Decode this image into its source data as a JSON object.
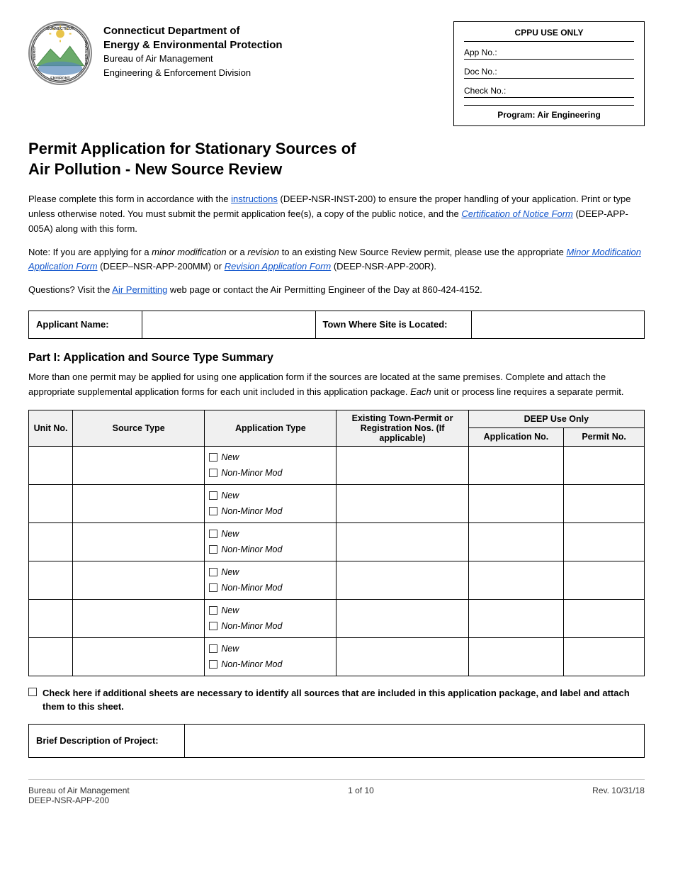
{
  "header": {
    "agency_line1": "Connecticut Department of",
    "agency_line2": "Energy & Environmental Protection",
    "agency_line3": "Bureau of Air Management",
    "agency_line4": "Engineering & Enforcement Division"
  },
  "cppu": {
    "title": "CPPU USE ONLY",
    "app_no_label": "App No.:",
    "doc_no_label": "Doc No.:",
    "check_no_label": "Check No.:",
    "program_label": "Program:  Air Engineering"
  },
  "page_title_line1": "Permit Application for Stationary Sources of",
  "page_title_line2": "Air Pollution - New Source Review",
  "intro1": "Please complete this form in accordance with the ",
  "intro1_link": "instructions",
  "intro1_mid": " (DEEP-NSR-INST-200) to ensure the proper handling of your application. Print or type unless otherwise noted. You must submit the permit application fee(s), a copy of the public notice, and the ",
  "intro1_link2": "Certification of Notice Form",
  "intro1_end": " (DEEP-APP-005A) along with this form.",
  "intro2_start": "Note: If you are applying for a ",
  "intro2_em1": "minor modification",
  "intro2_mid1": " or a ",
  "intro2_em2": "revision",
  "intro2_mid2": " to an existing New Source Review permit, please use the appropriate ",
  "intro2_link1": "Minor Modification Application Form",
  "intro2_mid3": " (DEEP–NSR-APP-200MM) or ",
  "intro2_link2": "Revision Application Form",
  "intro2_end": " (DEEP-NSR-APP-200R).",
  "intro3_start": "Questions? Visit the ",
  "intro3_link": "Air Permitting",
  "intro3_end": " web page or contact the Air Permitting Engineer of the Day at 860-424-4152.",
  "applicant": {
    "name_label": "Applicant Name:",
    "town_label": "Town Where Site is Located:"
  },
  "part1": {
    "title": "Part I:  Application and Source Type Summary",
    "description": "More than one permit may be applied for using one application form if the sources are located at the same premises. Complete and attach the appropriate supplemental application forms for each unit included in this application package. Each unit or process line requires a separate permit."
  },
  "table": {
    "headers": {
      "unit_no": "Unit No.",
      "source_type": "Source Type",
      "application_type": "Application Type",
      "existing_town": "Existing Town-Permit or Registration Nos. (If applicable)",
      "deep_use_only": "DEEP Use Only",
      "application_no": "Application No.",
      "permit_no": "Permit No."
    },
    "rows": [
      {
        "new_label": "New",
        "nonminor_label": "Non-Minor Mod"
      },
      {
        "new_label": "New",
        "nonminor_label": "Non-Minor Mod"
      },
      {
        "new_label": "New",
        "nonminor_label": "Non-Minor Mod"
      },
      {
        "new_label": "New",
        "nonminor_label": "Non-Minor Mod"
      },
      {
        "new_label": "New",
        "nonminor_label": "Non-Minor Mod"
      },
      {
        "new_label": "New",
        "nonminor_label": "Non-Minor Mod"
      }
    ]
  },
  "check_note": "Check here if additional sheets are necessary to identify all sources that are included in this application package, and label and attach them to this sheet.",
  "brief_desc_label": "Brief Description of Project:",
  "footer": {
    "left_line1": "Bureau of Air Management",
    "left_line2": "DEEP-NSR-APP-200",
    "center": "1 of 10",
    "right": "Rev. 10/31/18"
  }
}
